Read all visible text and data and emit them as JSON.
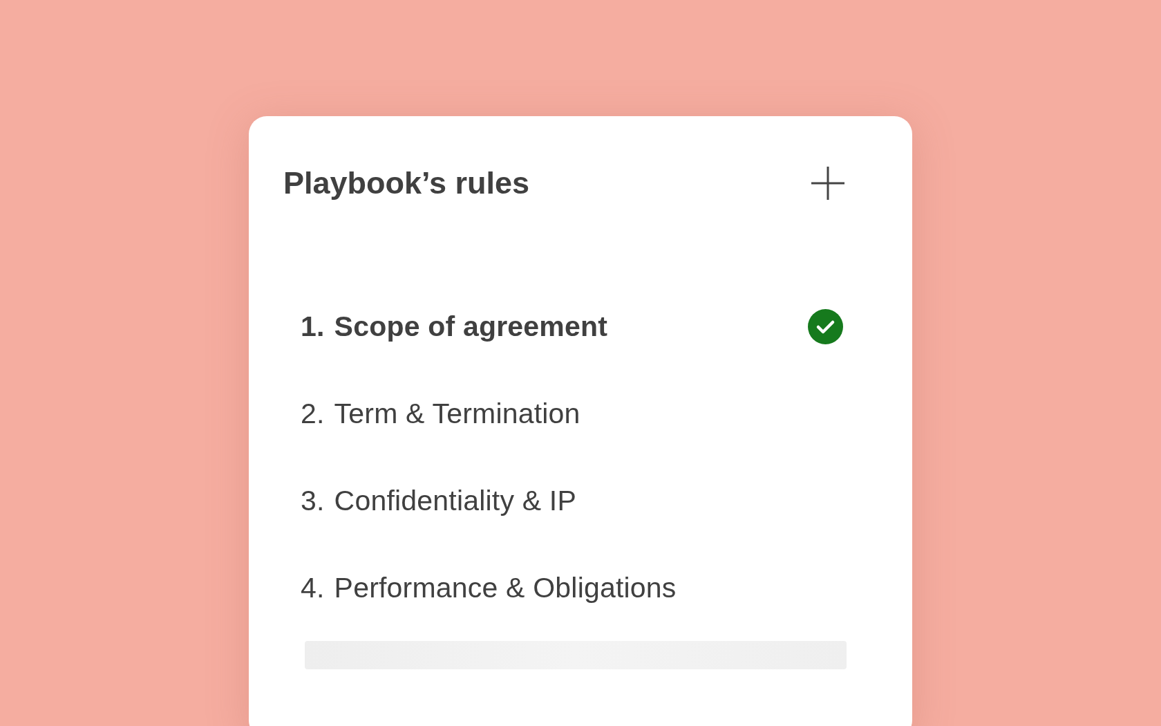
{
  "panel": {
    "title": "Playbook’s rules"
  },
  "rules": [
    {
      "number": "1.",
      "label": "Scope of agreement",
      "active": true,
      "checked": true
    },
    {
      "number": "2.",
      "label": "Term & Termination",
      "active": false,
      "checked": false
    },
    {
      "number": "3.",
      "label": "Confidentiality & IP",
      "active": false,
      "checked": false
    },
    {
      "number": "4.",
      "label": "Performance & Obligations",
      "active": false,
      "checked": false
    }
  ],
  "loading_placeholder": true
}
